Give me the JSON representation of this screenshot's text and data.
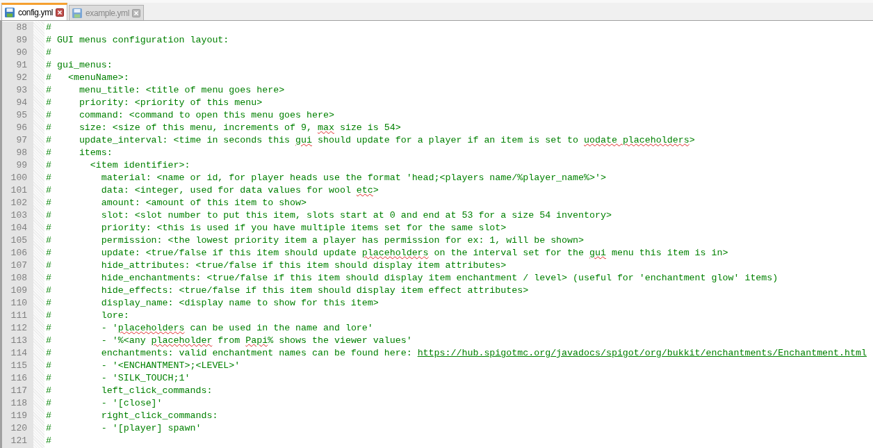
{
  "tabs": [
    {
      "label": "config.yml",
      "selected": true
    },
    {
      "label": "example.yml",
      "selected": false
    }
  ],
  "lines": [
    {
      "number": "88",
      "parts": [
        {
          "kind": "plain",
          "text": "#"
        }
      ]
    },
    {
      "number": "89",
      "parts": [
        {
          "kind": "plain",
          "text": "# GUI menus configuration layout:"
        }
      ]
    },
    {
      "number": "90",
      "parts": [
        {
          "kind": "plain",
          "text": "#"
        }
      ]
    },
    {
      "number": "91",
      "parts": [
        {
          "kind": "plain",
          "text": "# gui_menus:"
        }
      ]
    },
    {
      "number": "92",
      "parts": [
        {
          "kind": "plain",
          "text": "#   <menuName>:"
        }
      ]
    },
    {
      "number": "93",
      "parts": [
        {
          "kind": "plain",
          "text": "#     menu_title: <title of menu goes here>"
        }
      ]
    },
    {
      "number": "94",
      "parts": [
        {
          "kind": "plain",
          "text": "#     priority: <priority of this menu>"
        }
      ]
    },
    {
      "number": "95",
      "parts": [
        {
          "kind": "plain",
          "text": "#     command: <command to open this menu goes here>"
        }
      ]
    },
    {
      "number": "96",
      "parts": [
        {
          "kind": "plain",
          "text": "#     size: <size of this menu, increments of 9, "
        },
        {
          "kind": "misspelled",
          "text": "max"
        },
        {
          "kind": "plain",
          "text": " size is 54>"
        }
      ]
    },
    {
      "number": "97",
      "parts": [
        {
          "kind": "plain",
          "text": "#     update_interval: <time in seconds this "
        },
        {
          "kind": "misspelled",
          "text": "gui"
        },
        {
          "kind": "plain",
          "text": " should update for a player if an item is set to "
        },
        {
          "kind": "misspelled",
          "text": "uodate placeholders"
        },
        {
          "kind": "plain",
          "text": ">"
        }
      ]
    },
    {
      "number": "98",
      "parts": [
        {
          "kind": "plain",
          "text": "#     items:"
        }
      ]
    },
    {
      "number": "99",
      "parts": [
        {
          "kind": "plain",
          "text": "#       <item identifier>:"
        }
      ]
    },
    {
      "number": "100",
      "parts": [
        {
          "kind": "plain",
          "text": "#         material: <name or id, for player heads use the format 'head;<players name/%player_name%>'>"
        }
      ]
    },
    {
      "number": "101",
      "parts": [
        {
          "kind": "plain",
          "text": "#         data: <integer, used for data values for wool "
        },
        {
          "kind": "misspelled",
          "text": "etc"
        },
        {
          "kind": "plain",
          "text": ">"
        }
      ]
    },
    {
      "number": "102",
      "parts": [
        {
          "kind": "plain",
          "text": "#         amount: <amount of this item to show>"
        }
      ]
    },
    {
      "number": "103",
      "parts": [
        {
          "kind": "plain",
          "text": "#         slot: <slot number to put this item, slots start at 0 and end at 53 for a size 54 inventory>"
        }
      ]
    },
    {
      "number": "104",
      "parts": [
        {
          "kind": "plain",
          "text": "#         priority: <this is used if you have multiple items set for the same slot>"
        }
      ]
    },
    {
      "number": "105",
      "parts": [
        {
          "kind": "plain",
          "text": "#         permission: <the lowest priority item a player has permission for ex: 1, will be shown>"
        }
      ]
    },
    {
      "number": "106",
      "parts": [
        {
          "kind": "plain",
          "text": "#         update: <true/false if this item should update "
        },
        {
          "kind": "misspelled",
          "text": "placeholders"
        },
        {
          "kind": "plain",
          "text": " on the interval set for the "
        },
        {
          "kind": "misspelled",
          "text": "gui"
        },
        {
          "kind": "plain",
          "text": " menu this item is in>"
        }
      ]
    },
    {
      "number": "107",
      "parts": [
        {
          "kind": "plain",
          "text": "#         hide_attributes: <true/false if this item should display item attributes>"
        }
      ]
    },
    {
      "number": "108",
      "parts": [
        {
          "kind": "plain",
          "text": "#         hide_enchantments: <true/false if this item should display item enchantment / level> (useful for 'enchantment glow' items)"
        }
      ]
    },
    {
      "number": "109",
      "parts": [
        {
          "kind": "plain",
          "text": "#         hide_effects: <true/false if this item should display item effect attributes>"
        }
      ]
    },
    {
      "number": "110",
      "parts": [
        {
          "kind": "plain",
          "text": "#         display_name: <display name to show for this item>"
        }
      ]
    },
    {
      "number": "111",
      "parts": [
        {
          "kind": "plain",
          "text": "#         lore:"
        }
      ]
    },
    {
      "number": "112",
      "parts": [
        {
          "kind": "plain",
          "text": "#         - '"
        },
        {
          "kind": "misspelled",
          "text": "placeholders"
        },
        {
          "kind": "plain",
          "text": " can be used in the name and lore'"
        }
      ]
    },
    {
      "number": "113",
      "parts": [
        {
          "kind": "plain",
          "text": "#         - '%<any "
        },
        {
          "kind": "misspelled",
          "text": "placeholder"
        },
        {
          "kind": "plain",
          "text": " from "
        },
        {
          "kind": "misspelled",
          "text": "Papi"
        },
        {
          "kind": "plain",
          "text": "% shows the viewer values'"
        }
      ]
    },
    {
      "number": "114",
      "parts": [
        {
          "kind": "plain",
          "text": "#         enchantments: valid enchantment names can be found here: "
        },
        {
          "kind": "link",
          "text": "https://hub.spigotmc.org/javadocs/spigot/org/bukkit/enchantments/Enchantment.html"
        }
      ]
    },
    {
      "number": "115",
      "parts": [
        {
          "kind": "plain",
          "text": "#         - '<ENCHANTMENT>;<LEVEL>'"
        }
      ]
    },
    {
      "number": "116",
      "parts": [
        {
          "kind": "plain",
          "text": "#         - 'SILK_TOUCH;1'"
        }
      ]
    },
    {
      "number": "117",
      "parts": [
        {
          "kind": "plain",
          "text": "#         left_click_commands:"
        }
      ]
    },
    {
      "number": "118",
      "parts": [
        {
          "kind": "plain",
          "text": "#         - '[close]'"
        }
      ]
    },
    {
      "number": "119",
      "parts": [
        {
          "kind": "plain",
          "text": "#         right_click_commands:"
        }
      ]
    },
    {
      "number": "120",
      "parts": [
        {
          "kind": "plain",
          "text": "#         - '[player] spawn'"
        }
      ]
    },
    {
      "number": "121",
      "parts": [
        {
          "kind": "plain",
          "text": "#"
        }
      ]
    }
  ]
}
